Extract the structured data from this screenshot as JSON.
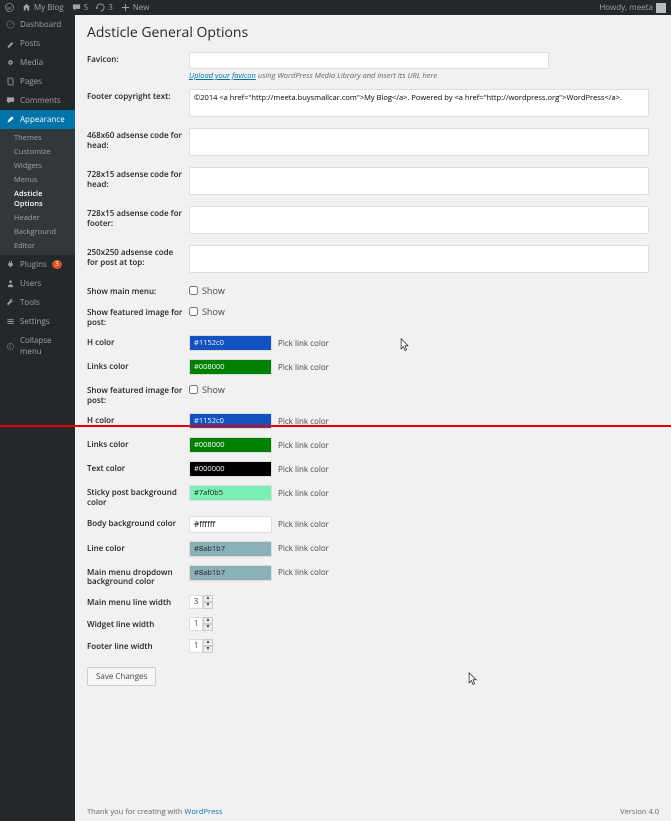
{
  "adminbar": {
    "site": "My Blog",
    "comments": "5",
    "updates": "3",
    "new": "New",
    "howdy": "Howdy, meeta"
  },
  "sidebar": {
    "dashboard": "Dashboard",
    "posts": "Posts",
    "media": "Media",
    "pages": "Pages",
    "comments": "Comments",
    "appearance": "Appearance",
    "submenu": {
      "themes": "Themes",
      "customize": "Customize",
      "widgets": "Widgets",
      "menus": "Menus",
      "adsticle": "Adsticle Options",
      "header": "Header",
      "background": "Background",
      "editor": "Editor"
    },
    "plugins": "Plugins",
    "plugins_badge": "3",
    "users": "Users",
    "tools": "Tools",
    "settings": "Settings",
    "collapse": "Collapse menu"
  },
  "page_title": "Adsticle General Options",
  "labels": {
    "favicon": "Favicon:",
    "upload_text": "Upload your favicon",
    "upload_hint": " using WordPress Media Library and insert its URL here",
    "footer_copyright": "Footer copyright text:",
    "adsense_468": "468x60 adsense code for head:",
    "adsense_728h": "728x15 adsense code for head:",
    "adsense_728f": "728x15 adsense code for footer:",
    "adsense_250": "250x250 adsense code for post at top:",
    "show_main_menu": "Show main menu:",
    "show_featured": "Show featured image for post:",
    "h_color": "H color",
    "links_color": "Links color",
    "text_color": "Text color",
    "sticky_bg": "Sticky post background color",
    "body_bg": "Body background color",
    "line_color": "Line color",
    "dropdown_bg": "Main menu dropdown background color",
    "mainmenu_line": "Main menu line width",
    "widget_line": "Widget line width",
    "footer_line": "Footer line width",
    "show": "Show",
    "pick": "Pick link color",
    "save": "Save Changes"
  },
  "values": {
    "footer_text": "©2014 <a href=\"http://meeta.buysmallcar.com\">My Blog</a>. Powered by <a href=\"http://wordpress.org\">WordPress</a>.",
    "h_color": "#1152c0",
    "links_color": "#008000",
    "text_color": "#000000",
    "sticky_bg": "#7af0b5",
    "body_bg": "#ffffff",
    "line_color": "#8ab1b7",
    "dropdown_bg": "#8ab1b7",
    "mainmenu_line": "3",
    "widget_line": "1",
    "footer_line": "1"
  },
  "footer": {
    "thank": "Thank you for creating with ",
    "wp": "WordPress",
    "version": "Version 4.0"
  }
}
